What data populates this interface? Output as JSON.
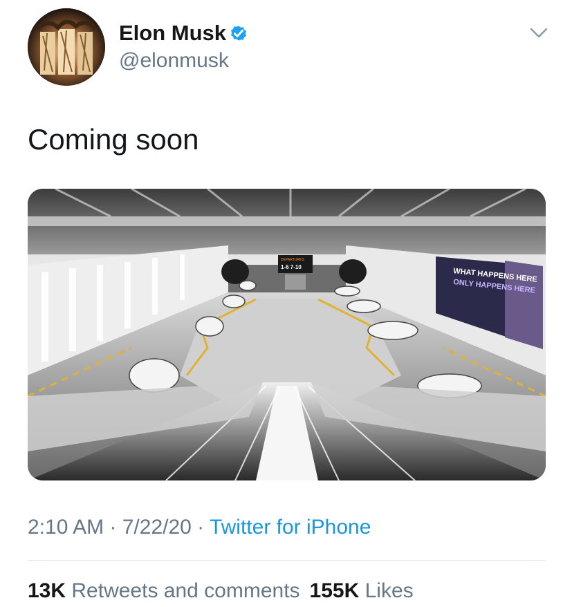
{
  "author": {
    "name": "Elon Musk",
    "handle": "@elonmusk",
    "verified": true,
    "verified_icon": "verified-badge-icon",
    "verified_color": "#1da1f2"
  },
  "tweet": {
    "text": "Coming soon",
    "media": {
      "signs": {
        "departures": "DEPARTURES",
        "gates": "1-6  7-10",
        "billboard_line1": "WHAT HAPPENS HERE",
        "billboard_line2": "ONLY HAPPENS HERE"
      }
    }
  },
  "meta": {
    "time": "2:10 AM",
    "sep1": " · ",
    "date": "7/22/20",
    "sep2": " · ",
    "source": "Twitter for iPhone"
  },
  "stats": {
    "retweets_count": "13K",
    "retweets_label": "Retweets and comments",
    "likes_count": "155K",
    "likes_label": "Likes"
  },
  "colors": {
    "text": "#14171a",
    "secondary": "#657786",
    "link": "#1b95e0",
    "divider": "#e1e8ed"
  }
}
